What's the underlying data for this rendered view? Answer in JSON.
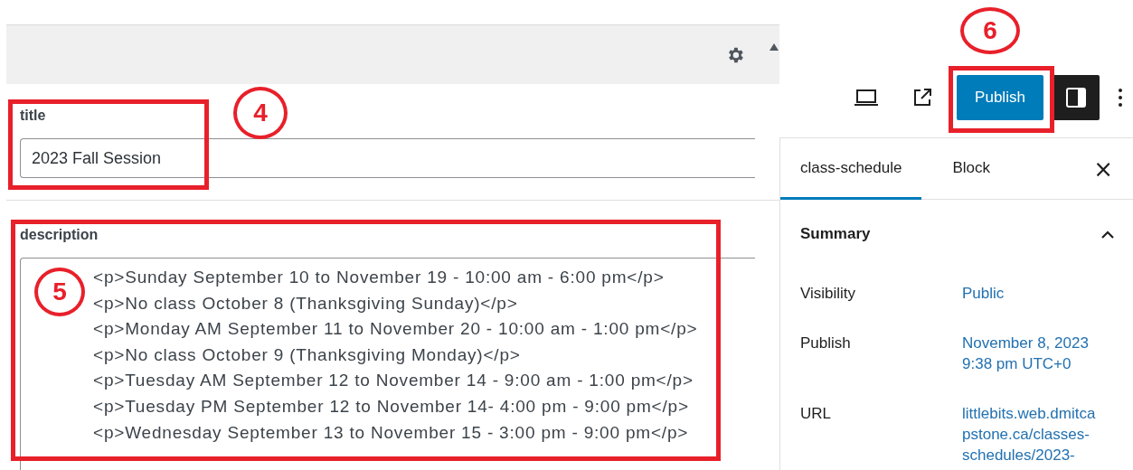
{
  "fields": [
    {
      "kind": "input",
      "label": "title",
      "value": "2023 Fall Session"
    },
    {
      "kind": "textarea",
      "label": "description",
      "lines": [
        "<p>Sunday September 10 to November 19 - 10:00 am - 6:00 pm</p>",
        "<p>No class October 8 (Thanksgiving Sunday)</p>",
        "<p>Monday AM September 11 to November 20 - 10:00 am - 1:00 pm</p>",
        "<p>No class October 9 (Thanksgiving Monday)</p>",
        "<p>Tuesday AM September 12 to November 14 - 9:00 am - 1:00 pm</p>",
        "<p>Tuesday PM September 12 to November 14- 4:00 pm - 9:00 pm</p>",
        "<p>Wednesday September 13 to November 15 - 3:00 pm - 9:00 pm</p>"
      ]
    }
  ],
  "toolbar": {
    "publish_button": "Publish"
  },
  "sidebar": {
    "tabs": [
      {
        "label": "class-schedule",
        "selected": true
      },
      {
        "label": "Block",
        "selected": false
      }
    ],
    "close": "×",
    "summary": {
      "title": "Summary",
      "expanded": true,
      "rows": [
        {
          "label": "Visibility",
          "value": "Public"
        },
        {
          "label": "Publish",
          "value": "November 8, 2023 9:38 pm UTC+0"
        },
        {
          "label": "URL",
          "value": "littlebits.web.dmitcapstone.ca/classes-schedules/2023-"
        }
      ]
    }
  },
  "annotations": [
    {
      "label": "4"
    },
    {
      "label": "5"
    },
    {
      "label": "6"
    }
  ]
}
